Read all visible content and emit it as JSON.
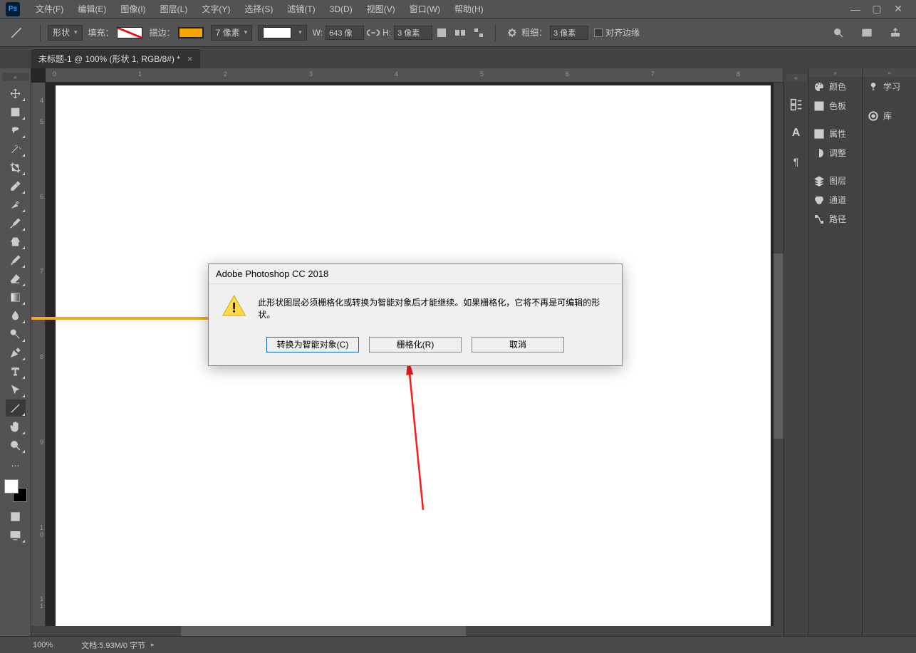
{
  "app": {
    "abbrev": "Ps"
  },
  "menu": {
    "file": "文件(F)",
    "edit": "编辑(E)",
    "image": "图像(I)",
    "layer": "图层(L)",
    "type": "文字(Y)",
    "select": "选择(S)",
    "filter": "滤镜(T)",
    "threeD": "3D(D)",
    "view": "视图(V)",
    "window": "窗口(W)",
    "help": "帮助(H)"
  },
  "options": {
    "mode": "形状",
    "fill_label": "填充：",
    "stroke_label": "描边：",
    "stroke_width": "7 像素",
    "w_label": "W:",
    "w_value": "643 像",
    "h_label": "H:",
    "h_value": "3 像素",
    "weight_label": "粗细：",
    "weight_value": "3 像素",
    "align_edges": "对齐边缘"
  },
  "tab": {
    "title": "未标题-1 @ 100% (形状 1, RGB/8#) *"
  },
  "panels": {
    "color": "颜色",
    "swatches": "色板",
    "properties": "属性",
    "adjustments": "调整",
    "layers": "图层",
    "channels": "通道",
    "paths": "路径",
    "learn": "学习",
    "libraries": "库"
  },
  "dialog": {
    "title": "Adobe Photoshop CC 2018",
    "message": "此形状图层必须栅格化或转换为智能对象后才能继续。如果栅格化，它将不再是可编辑的形状。",
    "convert": "转换为智能对象(C)",
    "rasterize": "栅格化(R)",
    "cancel": "取消"
  },
  "status": {
    "zoom": "100%",
    "docinfo": "文档:5.93M/0 字节"
  },
  "ruler_h": {
    "l0": "0",
    "l1": "1",
    "l2": "2",
    "l3": "3",
    "l4": "4",
    "l5": "5",
    "l6": "6",
    "l7": "7",
    "l8": "8"
  },
  "ruler_v": {
    "l4": "4",
    "l5": "5",
    "l6": "6",
    "l7": "7",
    "l8": "8",
    "l9": "9",
    "l10": "1\n0",
    "l11": "1\n1"
  }
}
